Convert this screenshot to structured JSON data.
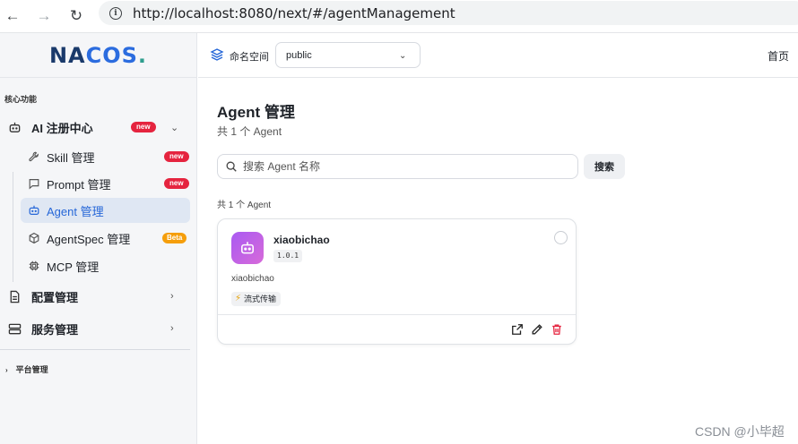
{
  "browser": {
    "url": "http://localhost:8080/next/#/agentManagement",
    "back_icon": "←",
    "forward_icon": "→",
    "reload_icon": "↻",
    "info_icon": "i"
  },
  "sidebar": {
    "logo": {
      "a": "NA",
      "b": "C",
      "c": "OS",
      "d": "."
    },
    "section_title": "核心功能",
    "ai_registry": {
      "label": "AI 注册中心",
      "badge": "new",
      "chevron": "⌄"
    },
    "ai_items": [
      {
        "label": "Skill 管理",
        "badge": "new"
      },
      {
        "label": "Prompt 管理",
        "badge": "new"
      },
      {
        "label": "Agent 管理",
        "badge": ""
      },
      {
        "label": "AgentSpec 管理",
        "badge": "Beta"
      },
      {
        "label": "MCP 管理",
        "badge": ""
      }
    ],
    "config_mgmt": {
      "label": "配置管理",
      "chevron": "›"
    },
    "service_mgmt": {
      "label": "服务管理",
      "chevron": "›"
    },
    "platform": {
      "label": "平台管理",
      "chevron": "›"
    }
  },
  "header": {
    "namespace_label": "命名空间",
    "namespace_value": "public",
    "namespace_chevron": "⌄",
    "home_link": "首页"
  },
  "main": {
    "title": "Agent 管理",
    "subtitle": "共 1 个 Agent",
    "search": {
      "placeholder": "搜索 Agent 名称",
      "value": "",
      "button": "搜索"
    },
    "count_line": "共 1 个 Agent",
    "agents": [
      {
        "name": "xiaobichao",
        "version": "1.0.1",
        "description": "xiaobichao",
        "tag": "流式传输",
        "tag_icon": "⚡",
        "avatar_gradient": [
          "#a95af2",
          "#d76ad9"
        ]
      }
    ]
  },
  "watermark": "CSDN @小毕超",
  "colors": {
    "accent": "#2667d8",
    "badge_new": "#e5243f",
    "badge_beta": "#f59e0b",
    "delete": "#e5243f"
  }
}
